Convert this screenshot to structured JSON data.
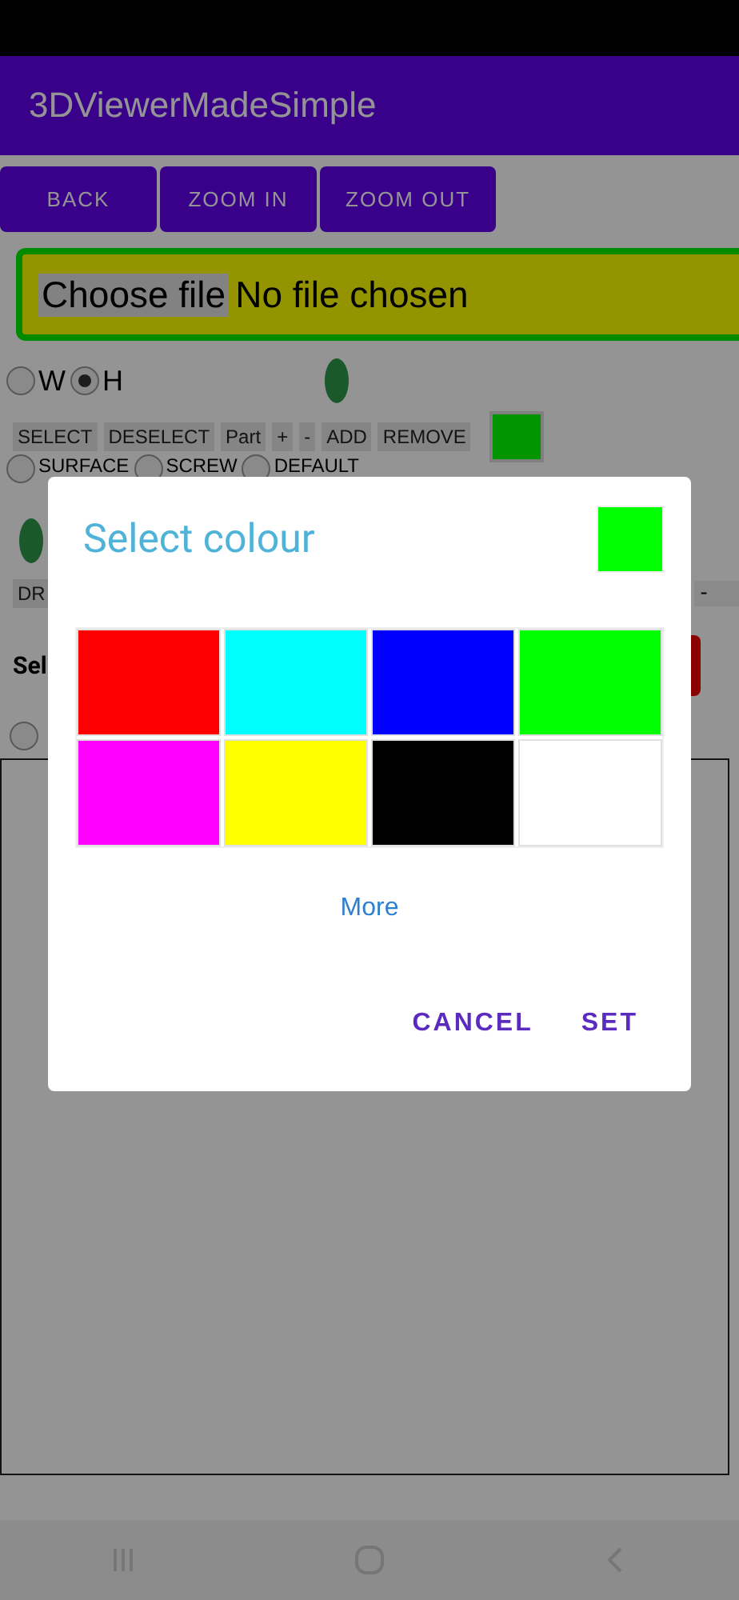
{
  "app_bar": {
    "title": "3DViewerMadeSimple"
  },
  "toolbar": [
    "BACK",
    "ZOOM IN",
    "ZOOM OUT"
  ],
  "file_input": {
    "button": "Choose file",
    "status": "No file chosen"
  },
  "axis_options": [
    {
      "label": "W",
      "selected": false
    },
    {
      "label": "H",
      "selected": true
    }
  ],
  "part_buttons": [
    "SELECT",
    "DESELECT",
    "Part",
    "+",
    "-",
    "ADD",
    "REMOVE"
  ],
  "type_options": [
    {
      "label": "SURFACE",
      "selected": false
    },
    {
      "label": "SCREW",
      "selected": false
    },
    {
      "label": "DEFAULT",
      "selected": false
    }
  ],
  "draw_button": "DR",
  "dropdown_end": "-",
  "select_label": "Sel",
  "lone_option": {
    "selected": false
  },
  "dialog": {
    "title": "Select colour",
    "preview": {
      "color": "#00ff00"
    },
    "palette": [
      {
        "color": "#ff0000"
      },
      {
        "color": "#00ffff"
      },
      {
        "color": "#0000ff"
      },
      {
        "color": "#00ff00"
      },
      {
        "color": "#ff00ff"
      },
      {
        "color": "#ffff00"
      },
      {
        "color": "#000000"
      },
      {
        "color": "#ffffff"
      }
    ],
    "more": "More",
    "buttons": [
      "CANCEL",
      "SET"
    ]
  }
}
